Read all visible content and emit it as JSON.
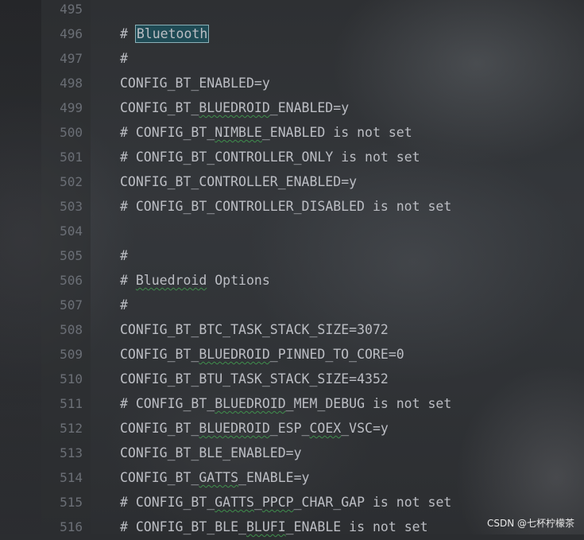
{
  "lines": [
    {
      "n": "495",
      "code": ""
    },
    {
      "n": "496",
      "code": "# ",
      "hl": "Bluetooth"
    },
    {
      "n": "497",
      "code": "#"
    },
    {
      "n": "498",
      "code": "CONFIG_BT_ENABLED=y"
    },
    {
      "n": "499",
      "code": "CONFIG_BT_BLUEDROID_ENABLED=y"
    },
    {
      "n": "500",
      "code": "# CONFIG_BT_NIMBLE_ENABLED is not set"
    },
    {
      "n": "501",
      "code": "# CONFIG_BT_CONTROLLER_ONLY is not set"
    },
    {
      "n": "502",
      "code": "CONFIG_BT_CONTROLLER_ENABLED=y"
    },
    {
      "n": "503",
      "code": "# CONFIG_BT_CONTROLLER_DISABLED is not set"
    },
    {
      "n": "504",
      "code": ""
    },
    {
      "n": "505",
      "code": "#"
    },
    {
      "n": "506",
      "code": "# Bluedroid Options"
    },
    {
      "n": "507",
      "code": "#"
    },
    {
      "n": "508",
      "code": "CONFIG_BT_BTC_TASK_STACK_SIZE=3072"
    },
    {
      "n": "509",
      "code": "CONFIG_BT_BLUEDROID_PINNED_TO_CORE=0"
    },
    {
      "n": "510",
      "code": "CONFIG_BT_BTU_TASK_STACK_SIZE=4352"
    },
    {
      "n": "511",
      "code": "# CONFIG_BT_BLUEDROID_MEM_DEBUG is not set"
    },
    {
      "n": "512",
      "code": "CONFIG_BT_BLUEDROID_ESP_COEX_VSC=y"
    },
    {
      "n": "513",
      "code": "CONFIG_BT_BLE_ENABLED=y"
    },
    {
      "n": "514",
      "code": "CONFIG_BT_GATTS_ENABLE=y"
    },
    {
      "n": "515",
      "code": "# CONFIG_BT_GATTS_PPCP_CHAR_GAP is not set"
    },
    {
      "n": "516",
      "code": "# CONFIG_BT_BLE_BLUFI_ENABLE is not set"
    }
  ],
  "squiggle_words": [
    "BLUEDROID",
    "NIMBLE",
    "GATTS",
    "PPCP",
    "BLUFI",
    "COEX",
    "Bluedroid"
  ],
  "watermark": "CSDN @七杯柠檬茶",
  "colors": {
    "code_text": "#bcbec4",
    "line_number": "#6b6f76",
    "selection_bg": "#1f4b55",
    "squiggle": "#3f8f4c"
  }
}
